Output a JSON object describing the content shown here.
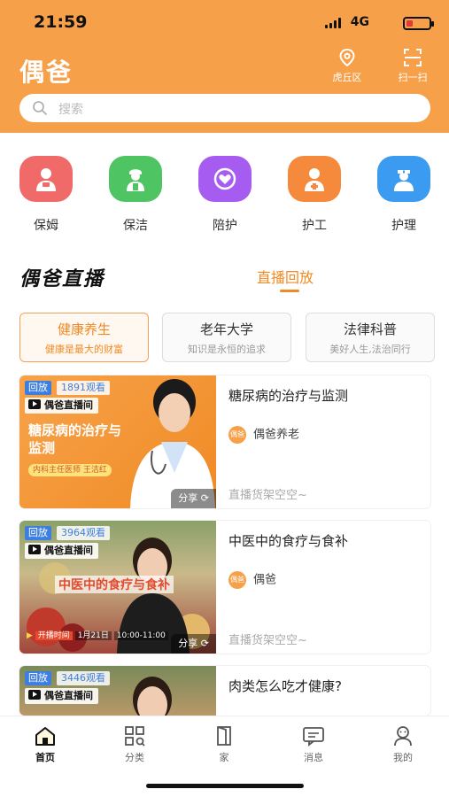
{
  "status_bar": {
    "time": "21:59",
    "network": "4G"
  },
  "header": {
    "brand": "偶爸",
    "location_label": "虎丘区",
    "scan_label": "扫一扫",
    "search_placeholder": "搜索"
  },
  "categories": [
    {
      "label": "保姆",
      "color": "#f06a6a",
      "icon": "nanny-icon"
    },
    {
      "label": "保洁",
      "color": "#4fc463",
      "icon": "cleaning-icon"
    },
    {
      "label": "陪护",
      "color": "#a65cf0",
      "icon": "companion-icon"
    },
    {
      "label": "护工",
      "color": "#f58a3c",
      "icon": "caregiver-icon"
    },
    {
      "label": "护理",
      "color": "#3a9bf0",
      "icon": "nurse-icon"
    }
  ],
  "live_section": {
    "title": "偶爸直播",
    "tab_replay": "直播回放"
  },
  "topics": [
    {
      "title": "健康养生",
      "subtitle": "健康是最大的财富",
      "active": true
    },
    {
      "title": "老年大学",
      "subtitle": "知识是永恒的追求",
      "active": false
    },
    {
      "title": "法律科普",
      "subtitle": "美好人生,法治同行",
      "active": false
    }
  ],
  "videos": [
    {
      "replay_tag": "回放",
      "views": "1891观看",
      "live_tag": "偶爸直播间",
      "overlay_title": "糖尿病的治疗与监测",
      "doctor_tag": "内科主任医师 王洁红",
      "share": "分享",
      "title": "糖尿病的治疗与监测",
      "author_logo": "偶爸",
      "author": "偶爸养老",
      "goods": "直播货架空空~"
    },
    {
      "replay_tag": "回放",
      "views": "3964观看",
      "live_tag": "偶爸直播间",
      "overlay_title": "中医中的食疗与食补",
      "share": "分享",
      "title": "中医中的食疗与食补",
      "author_logo": "偶爸",
      "author": "偶爸",
      "goods": "直播货架空空~",
      "start_label": "开播时间",
      "start_date": "1月21日",
      "start_time": "10:00-11:00"
    },
    {
      "replay_tag": "回放",
      "views": "3446观看",
      "live_tag": "偶爸直播间",
      "title": "肉类怎么吃才健康?"
    }
  ],
  "tabbar": [
    {
      "label": "首页",
      "icon": "home-icon",
      "active": true
    },
    {
      "label": "分类",
      "icon": "category-icon",
      "active": false
    },
    {
      "label": "家",
      "icon": "door-icon",
      "active": false
    },
    {
      "label": "消息",
      "icon": "message-icon",
      "active": false
    },
    {
      "label": "我的",
      "icon": "profile-icon",
      "active": false
    }
  ]
}
